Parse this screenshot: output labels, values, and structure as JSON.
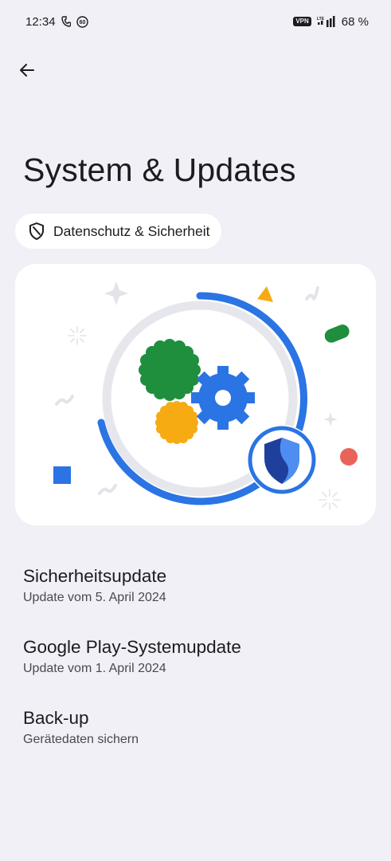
{
  "status_bar": {
    "time": "12:34",
    "notification_icons": [
      "phone-icon",
      "badge-60-icon"
    ],
    "badge_text": "60",
    "vpn_label": "VPN",
    "network_label": "LTE",
    "battery": "68 %"
  },
  "header": {
    "back_icon": "arrow-left-icon",
    "title": "System & Updates"
  },
  "chip": {
    "icon": "shield-icon",
    "label": "Datenschutz & Sicherheit"
  },
  "hero": {
    "illustration": "gears-with-shield-progress-ring",
    "colors": {
      "ring": "#2a74e4",
      "ring_track": "#e6e7ec",
      "gear_green": "#1f8e3d",
      "gear_yellow": "#f6ab12",
      "gear_blue": "#2a74e4",
      "shield_dark": "#1f3f9c",
      "shield_light": "#4e8ef0"
    }
  },
  "items": [
    {
      "title": "Sicherheitsupdate",
      "subtitle": "Update vom 5. April 2024"
    },
    {
      "title": "Google Play-Systemupdate",
      "subtitle": "Update vom 1. April 2024"
    },
    {
      "title": "Back-up",
      "subtitle": "Gerätedaten sichern"
    }
  ]
}
